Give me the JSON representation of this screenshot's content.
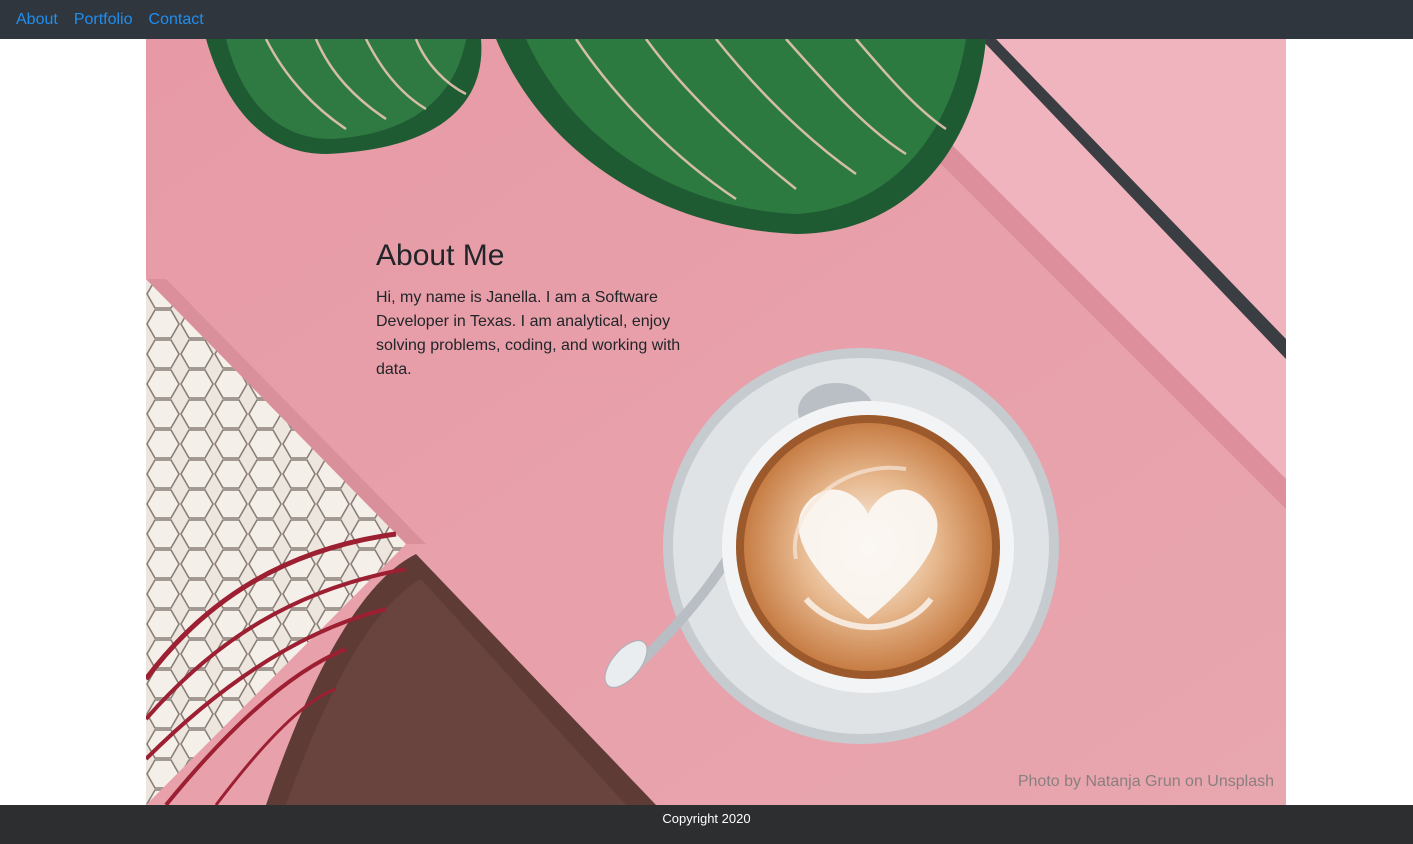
{
  "nav": {
    "links": [
      {
        "label": "About"
      },
      {
        "label": "Portfolio"
      },
      {
        "label": "Contact"
      }
    ]
  },
  "hero": {
    "image_icon": "coffee-table-photo",
    "heading": "About Me",
    "text": "Hi, my name is Janella. I am a Software Developer in Texas. I am analytical, enjoy solving problems, coding, and working with data.",
    "credit": "Photo by Natanja Grun on Unsplash"
  },
  "footer": {
    "copyright": "Copyright 2020"
  },
  "colors": {
    "navbar_bg": "#30363e",
    "link": "#1f8ef0",
    "footer_bg": "#2c2e30",
    "table_pink": "#e8a1aa"
  }
}
